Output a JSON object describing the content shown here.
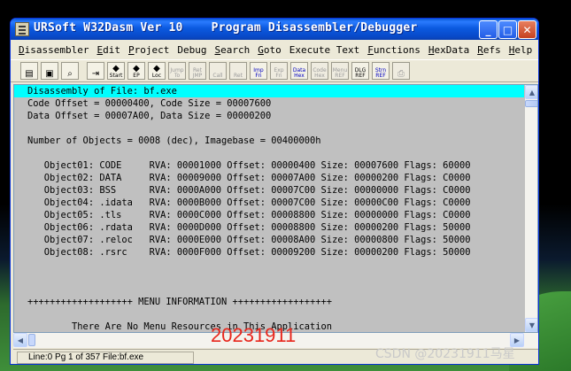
{
  "window": {
    "title": "URSoft W32Dasm Ver 10    Program Disassembler/Debugger",
    "minimize_glyph": "_",
    "maximize_glyph": "□",
    "close_glyph": "✕"
  },
  "menu": [
    {
      "label": "Disassembler",
      "u": "D",
      "rest": "isassembler"
    },
    {
      "label": "Edit",
      "u": "E",
      "rest": "dit"
    },
    {
      "label": "Project",
      "u": "P",
      "rest": "roject"
    },
    {
      "label": "Debug",
      "u": "",
      "rest": "Debug"
    },
    {
      "label": "Search",
      "u": "S",
      "rest": "earch"
    },
    {
      "label": "Goto",
      "u": "G",
      "rest": "oto"
    },
    {
      "label": "Execute Text",
      "u": "",
      "rest": "Execute Text"
    },
    {
      "label": "Functions",
      "u": "F",
      "rest": "unctions"
    },
    {
      "label": "HexData",
      "u": "H",
      "rest": "exData"
    },
    {
      "label": "Refs",
      "u": "R",
      "rest": "efs"
    },
    {
      "label": "Help",
      "u": "H",
      "rest": "elp"
    }
  ],
  "toolbar": [
    {
      "name": "open-file-icon",
      "glyph": "▤",
      "text": "",
      "disabled": false
    },
    {
      "name": "save-file-icon",
      "glyph": "▣",
      "text": "",
      "disabled": false
    },
    {
      "name": "find-text-icon",
      "glyph": "⌕",
      "text": "",
      "disabled": false
    },
    {
      "name": "separator",
      "sep": true
    },
    {
      "name": "goto-code-start-icon",
      "glyph": "⇥",
      "text": "",
      "disabled": false
    },
    {
      "name": "goto-program-start-icon",
      "glyph": "◆",
      "text": "Start",
      "disabled": false
    },
    {
      "name": "goto-entry-point-icon",
      "glyph": "◆",
      "text": "EP",
      "disabled": false
    },
    {
      "name": "goto-code-location-icon",
      "glyph": "◆",
      "text": "Loc",
      "disabled": false
    },
    {
      "name": "execute-jump-icon",
      "glyph": "Jump",
      "text": "To",
      "disabled": true
    },
    {
      "name": "return-from-jump-icon",
      "glyph": "Ret",
      "text": "JMP",
      "disabled": true
    },
    {
      "name": "execute-call-icon",
      "glyph": "Call",
      "text": "",
      "disabled": true
    },
    {
      "name": "return-from-call-icon",
      "glyph": "Ret",
      "text": "",
      "disabled": true
    },
    {
      "name": "imports-icon",
      "glyph": "Imp",
      "text": "Fn",
      "disabled": false,
      "blue": true
    },
    {
      "name": "exports-icon",
      "glyph": "Exp",
      "text": "Fn",
      "disabled": true
    },
    {
      "name": "data-hex-icon",
      "glyph": "Data",
      "text": "Hex",
      "disabled": false,
      "blue": true
    },
    {
      "name": "code-hex-icon",
      "glyph": "Code",
      "text": "Hex",
      "disabled": true
    },
    {
      "name": "menu-refs-icon",
      "glyph": "Menu",
      "text": "REF",
      "disabled": true
    },
    {
      "name": "dialog-refs-icon",
      "glyph": "DLG",
      "text": "REF",
      "disabled": false
    },
    {
      "name": "string-refs-icon",
      "glyph": "Strn",
      "text": "REF",
      "disabled": false,
      "blue": true
    },
    {
      "name": "print-icon",
      "glyph": "⎙",
      "text": "",
      "disabled": true
    }
  ],
  "listing": [
    {
      "text": "Disassembly of File: bf.exe",
      "selected": true
    },
    {
      "text": "Code Offset = 00000400, Code Size = 00007600"
    },
    {
      "text": "Data Offset = 00007A00, Data Size = 00000200"
    },
    {
      "text": ""
    },
    {
      "text": "Number of Objects = 0008 (dec), Imagebase = 00400000h"
    },
    {
      "text": ""
    },
    {
      "text": "   Object01: CODE     RVA: 00001000 Offset: 00000400 Size: 00007600 Flags: 60000"
    },
    {
      "text": "   Object02: DATA     RVA: 00009000 Offset: 00007A00 Size: 00000200 Flags: C0000"
    },
    {
      "text": "   Object03: BSS      RVA: 0000A000 Offset: 00007C00 Size: 00000000 Flags: C0000"
    },
    {
      "text": "   Object04: .idata   RVA: 0000B000 Offset: 00007C00 Size: 00000C00 Flags: C0000"
    },
    {
      "text": "   Object05: .tls     RVA: 0000C000 Offset: 00008800 Size: 00000000 Flags: C0000"
    },
    {
      "text": "   Object06: .rdata   RVA: 0000D000 Offset: 00008800 Size: 00000200 Flags: 50000"
    },
    {
      "text": "   Object07: .reloc   RVA: 0000E000 Offset: 00008A00 Size: 00000800 Flags: 50000"
    },
    {
      "text": "   Object08: .rsrc    RVA: 0000F000 Offset: 00009200 Size: 00000200 Flags: 50000"
    },
    {
      "text": ""
    },
    {
      "text": ""
    },
    {
      "text": ""
    },
    {
      "text": "+++++++++++++++++++ MENU INFORMATION ++++++++++++++++++"
    },
    {
      "text": ""
    },
    {
      "text": "        There Are No Menu Resources in This Application"
    }
  ],
  "scroll": {
    "up": "▲",
    "down": "▼",
    "left": "◀",
    "right": "▶"
  },
  "status": "Line:0 Pg 1 of 357  File:bf.exe",
  "overlay_number": "20231911",
  "watermark": "CSDN @20231911马星"
}
